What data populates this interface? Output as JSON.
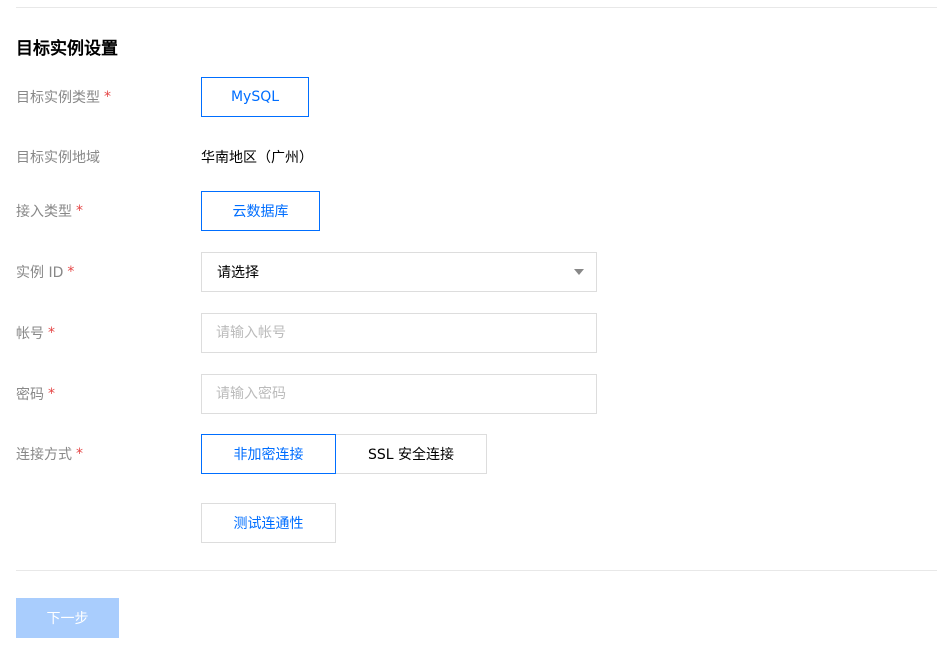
{
  "section": {
    "title": "目标实例设置"
  },
  "form": {
    "instance_type": {
      "label": "目标实例类型",
      "required_mark": "*",
      "option": "MySQL"
    },
    "region": {
      "label": "目标实例地域",
      "value": "华南地区（广州）"
    },
    "access_type": {
      "label": "接入类型",
      "required_mark": "*",
      "option": "云数据库"
    },
    "instance_id": {
      "label": "实例 ID",
      "required_mark": "*",
      "selected": "请选择"
    },
    "account": {
      "label": "帐号",
      "required_mark": "*",
      "placeholder": "请输入帐号"
    },
    "password": {
      "label": "密码",
      "required_mark": "*",
      "placeholder": "请输入密码"
    },
    "connection": {
      "label": "连接方式",
      "required_mark": "*",
      "options": [
        "非加密连接",
        "SSL 安全连接"
      ],
      "selected_index": 0
    },
    "test_button": "测试连通性"
  },
  "footer": {
    "next_label": "下一步"
  },
  "colors": {
    "accent": "#006eff",
    "required": "#e54545",
    "disabled_button": "#a9cdfd",
    "border": "#dddddd",
    "label": "#888888"
  }
}
